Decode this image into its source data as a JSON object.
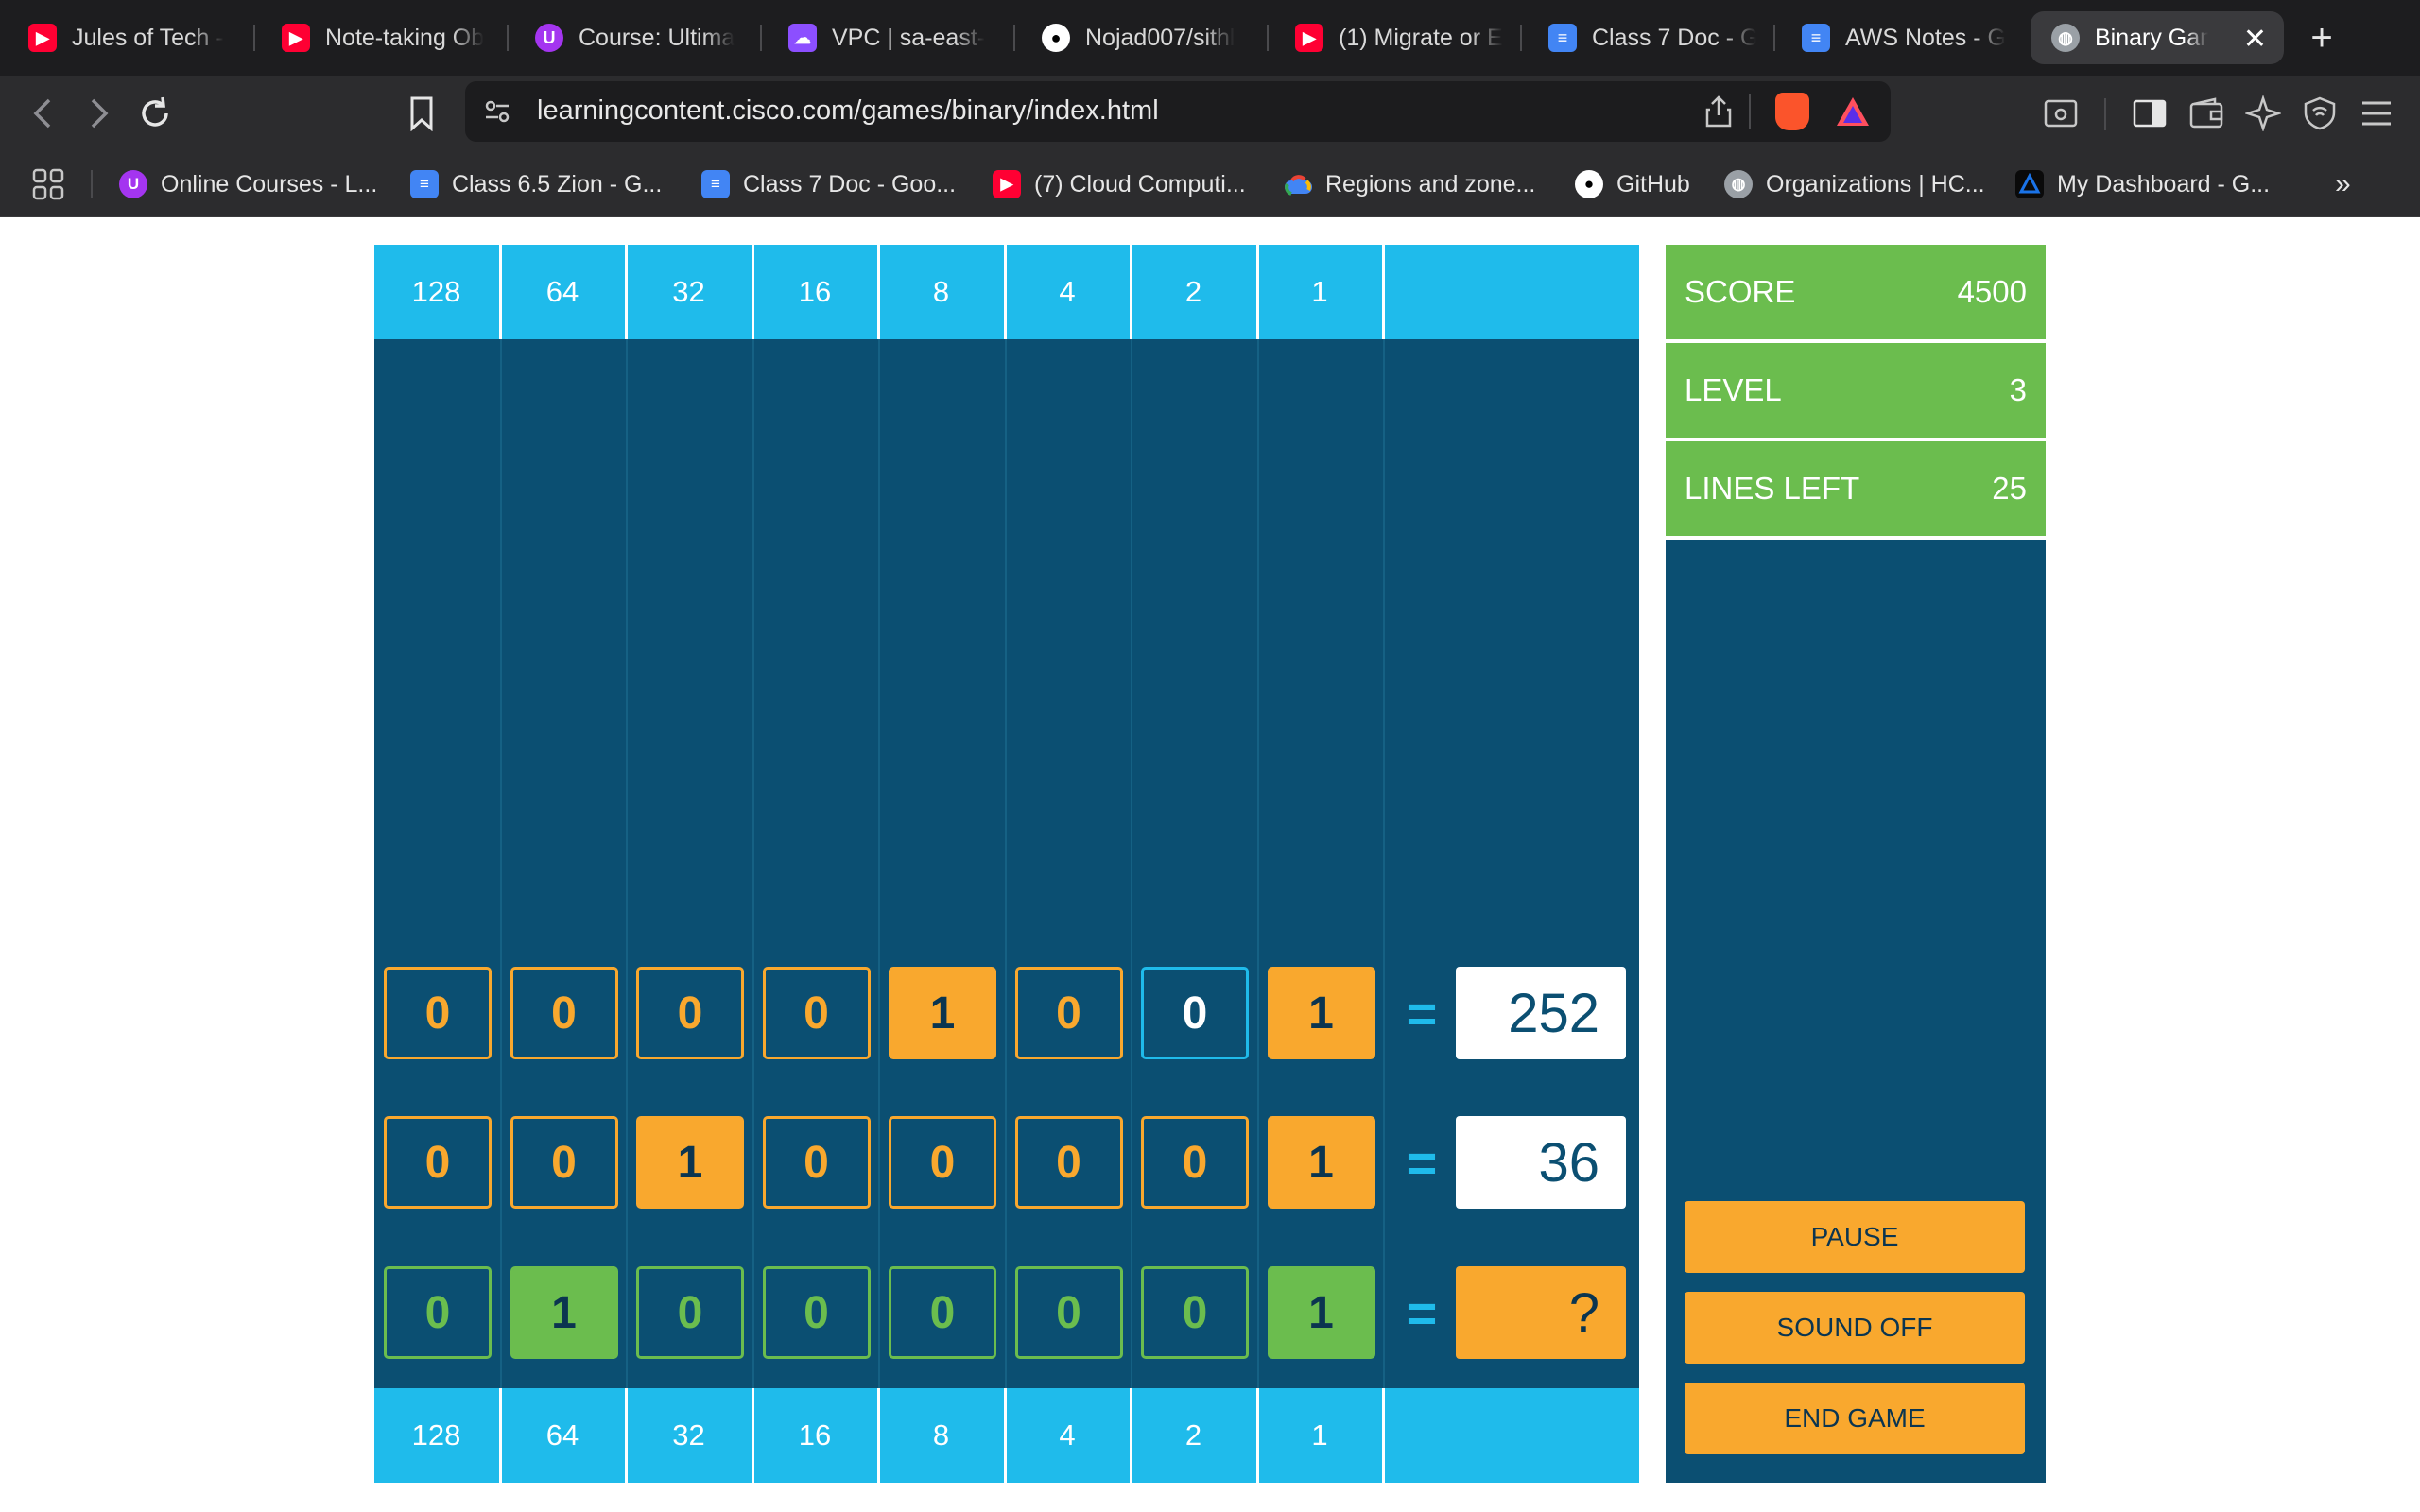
{
  "browser": {
    "tabs": [
      {
        "label": "Jules of Tech -",
        "icon": "youtube-icon",
        "color": "#ff0033"
      },
      {
        "label": "Note-taking Ob",
        "icon": "youtube-icon",
        "color": "#ff0033"
      },
      {
        "label": "Course: Ultima",
        "icon": "udemy-icon",
        "color": "#a435f0"
      },
      {
        "label": "VPC | sa-east-",
        "icon": "aws-vpc-icon",
        "color": "#8c4fff"
      },
      {
        "label": "Nojad007/sithl",
        "icon": "github-icon",
        "color": "#ffffff"
      },
      {
        "label": "(1) Migrate or E",
        "icon": "youtube-icon",
        "color": "#ff0033"
      },
      {
        "label": "Class 7 Doc - G",
        "icon": "google-docs-icon",
        "color": "#4285f4"
      },
      {
        "label": "AWS Notes - G",
        "icon": "google-docs-icon",
        "color": "#4285f4"
      },
      {
        "label": "Binary Gan",
        "icon": "globe-icon",
        "color": "#9aa0a6"
      }
    ],
    "url": "learningcontent.cisco.com/games/binary/index.html",
    "bookmarks": [
      {
        "label": "Online Courses - L...",
        "icon": "udemy-icon",
        "color": "#a435f0"
      },
      {
        "label": "Class 6.5 Zion - G...",
        "icon": "google-docs-icon",
        "color": "#4285f4"
      },
      {
        "label": "Class 7 Doc - Goo...",
        "icon": "google-docs-icon",
        "color": "#4285f4"
      },
      {
        "label": "(7) Cloud Computi...",
        "icon": "youtube-icon",
        "color": "#ff0033"
      },
      {
        "label": "Regions and zone...",
        "icon": "google-cloud-icon",
        "color": "#4285f4"
      },
      {
        "label": "GitHub",
        "icon": "github-icon",
        "color": "#ffffff"
      },
      {
        "label": "Organizations | HC...",
        "icon": "globe-icon",
        "color": "#9aa0a6"
      },
      {
        "label": "My Dashboard - G...",
        "icon": "dashboard-icon",
        "color": "#1a73e8"
      }
    ]
  },
  "game": {
    "place_values": [
      "128",
      "64",
      "32",
      "16",
      "8",
      "4",
      "2",
      "1"
    ],
    "rows": [
      {
        "bits": [
          "0",
          "0",
          "0",
          "0",
          "1",
          "0",
          "0",
          "1"
        ],
        "answer": "252",
        "color": "orange",
        "selected_index": 6
      },
      {
        "bits": [
          "0",
          "0",
          "1",
          "0",
          "0",
          "0",
          "0",
          "1"
        ],
        "answer": "36",
        "color": "orange",
        "selected_index": -1
      },
      {
        "bits": [
          "0",
          "1",
          "0",
          "0",
          "0",
          "0",
          "0",
          "1"
        ],
        "answer": "?",
        "color": "green",
        "selected_index": -1
      }
    ],
    "equals_sign": "="
  },
  "sidebar": {
    "score_label": "SCORE",
    "score": "4500",
    "level_label": "LEVEL",
    "level": "3",
    "lines_label": "LINES LEFT",
    "lines_left": "25",
    "pause_label": "PAUSE",
    "sound_label": "SOUND OFF",
    "end_label": "END GAME"
  },
  "colors": {
    "board": "#0b4f72",
    "header": "#1fbbeb",
    "orange": "#f9a82e",
    "green": "#6bbd4e"
  }
}
